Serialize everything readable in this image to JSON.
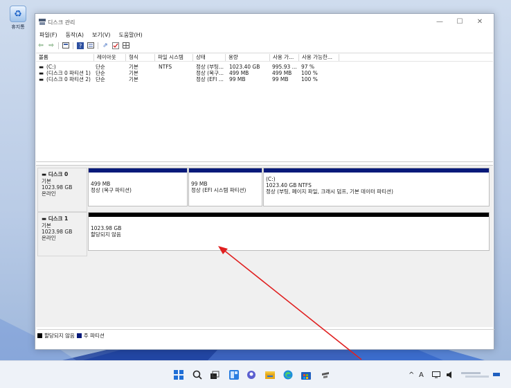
{
  "desktop": {
    "recycle_label": "휴지통"
  },
  "window": {
    "title": "디스크 관리",
    "controls": {
      "minimize": "—",
      "maximize": "☐",
      "close": "✕"
    },
    "menu": [
      "파일(F)",
      "동작(A)",
      "보기(V)",
      "도움말(H)"
    ]
  },
  "volume_list": {
    "headers": [
      "볼륨",
      "레이아웃",
      "형식",
      "파일 시스템",
      "상태",
      "용량",
      "사용 가...",
      "사용 가능한..."
    ],
    "rows": [
      {
        "volume": "(C:)",
        "layout": "단순",
        "type": "기본",
        "fs": "NTFS",
        "status": "정상 (부팅...",
        "capacity": "1023.40 GB",
        "free": "995.93 ...",
        "pct": "97 %"
      },
      {
        "volume": "(디스크 0 파티션 1)",
        "layout": "단순",
        "type": "기본",
        "fs": "",
        "status": "정상 (복구...",
        "capacity": "499 MB",
        "free": "499 MB",
        "pct": "100 %"
      },
      {
        "volume": "(디스크 0 파티션 2)",
        "layout": "단순",
        "type": "기본",
        "fs": "",
        "status": "정상 (EFI ...",
        "capacity": "99 MB",
        "free": "99 MB",
        "pct": "100 %"
      }
    ]
  },
  "disks": [
    {
      "name": "디스크 0",
      "kind": "기본",
      "size": "1023.98 GB",
      "state": "온라인",
      "partitions": [
        {
          "line1": "499 MB",
          "line2": "정상 (복구 파티션)"
        },
        {
          "line1": "99 MB",
          "line2": "정상 (EFI 시스템 파티션)"
        },
        {
          "line0": "(C:)",
          "line1": "1023.40 GB NTFS",
          "line2": "정상 (부팅, 페이지 파일, 크래시 덤프, 기본 데이터 파티션)"
        }
      ]
    },
    {
      "name": "디스크 1",
      "kind": "기본",
      "size": "1023.98 GB",
      "state": "온라인",
      "partitions": [
        {
          "line1": "1023.98 GB",
          "line2": "할당되지 않음"
        }
      ]
    }
  ],
  "legend": {
    "unallocated": "할당되지 않음",
    "primary": "주 파티션"
  },
  "colors": {
    "primary_partition": "#081a7a",
    "unallocated": "#000000",
    "annotation_arrow": "#e02020"
  },
  "taskbar": {
    "icons": [
      "windows-start-icon",
      "search-icon",
      "task-view-icon",
      "widgets-icon",
      "chat-icon",
      "file-explorer-icon",
      "edge-icon",
      "store-icon",
      "settings-icon"
    ],
    "tray": {
      "caret": "^",
      "input": "A"
    }
  }
}
